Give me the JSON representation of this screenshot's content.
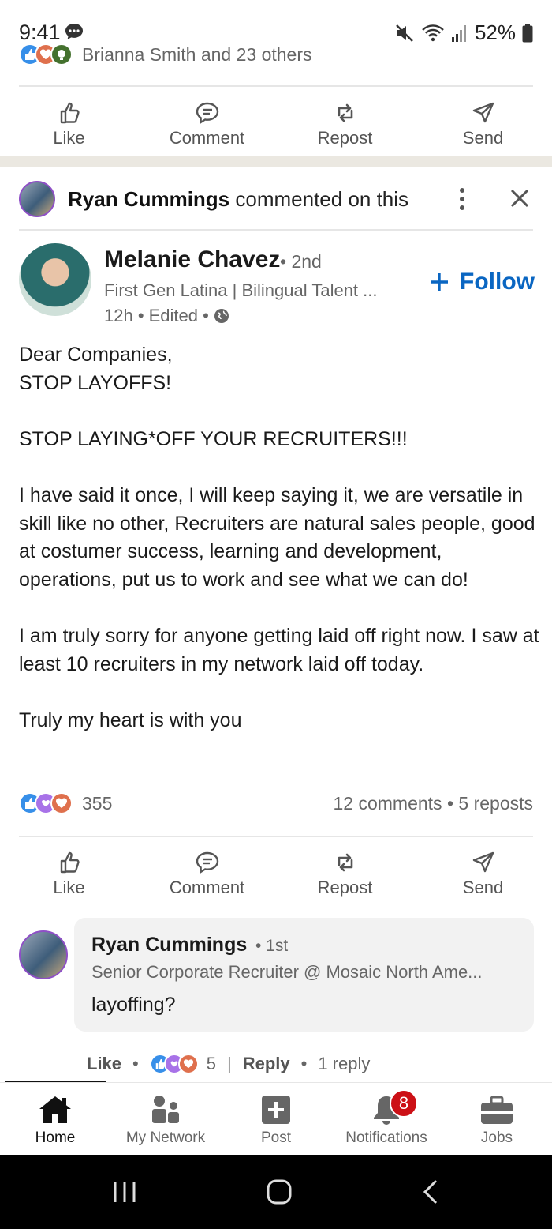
{
  "status_bar": {
    "time": "9:41",
    "battery": "52%"
  },
  "top_reactions": {
    "names": "Brianna Smith and 23 others"
  },
  "action_bar": {
    "like": "Like",
    "comment": "Comment",
    "repost": "Repost",
    "send": "Send"
  },
  "activity_header": {
    "actor": "Ryan Cummings",
    "action": " commented on this"
  },
  "post": {
    "author": {
      "name": "Melanie Chavez",
      "degree": "• 2nd",
      "headline": "First Gen Latina | Bilingual Talent ...",
      "time": "12h • Edited •"
    },
    "follow_label": "Follow",
    "body": [
      "Dear Companies,",
      "STOP LAYOFFS!",
      "",
      "STOP LAYING*OFF YOUR RECRUITERS!!!",
      "",
      "I have said it once, I will keep saying it, we are versatile in skill like no other, Recruiters are natural sales people, good at costumer success, learning and development, operations, put us to work and see what we can do!",
      "",
      "I am truly sorry for anyone getting laid off right now. I saw at least 10 recruiters in my network laid off today.",
      "",
      "Truly my heart is with you"
    ],
    "reaction_count": "355",
    "engagement": "12 comments • 5 reposts"
  },
  "comment": {
    "author": "Ryan Cummings",
    "degree": "• 1st",
    "headline": "Senior Corporate Recruiter @ Mosaic North Ame...",
    "text": "layoffing?",
    "like_label": "Like",
    "reaction_count": "5",
    "reply_label": "Reply",
    "replies": "1 reply"
  },
  "bottom_nav": {
    "tabs": [
      {
        "label": "Home",
        "icon": "home-icon"
      },
      {
        "label": "My Network",
        "icon": "network-icon"
      },
      {
        "label": "Post",
        "icon": "post-icon"
      },
      {
        "label": "Notifications",
        "icon": "bell-icon"
      },
      {
        "label": "Jobs",
        "icon": "briefcase-icon"
      }
    ],
    "notification_badge": "8"
  },
  "colors": {
    "accent": "#0a66c2",
    "badge": "#cc1016",
    "like": "#378fe9",
    "love": "#df704d",
    "support": "#a872e8"
  }
}
